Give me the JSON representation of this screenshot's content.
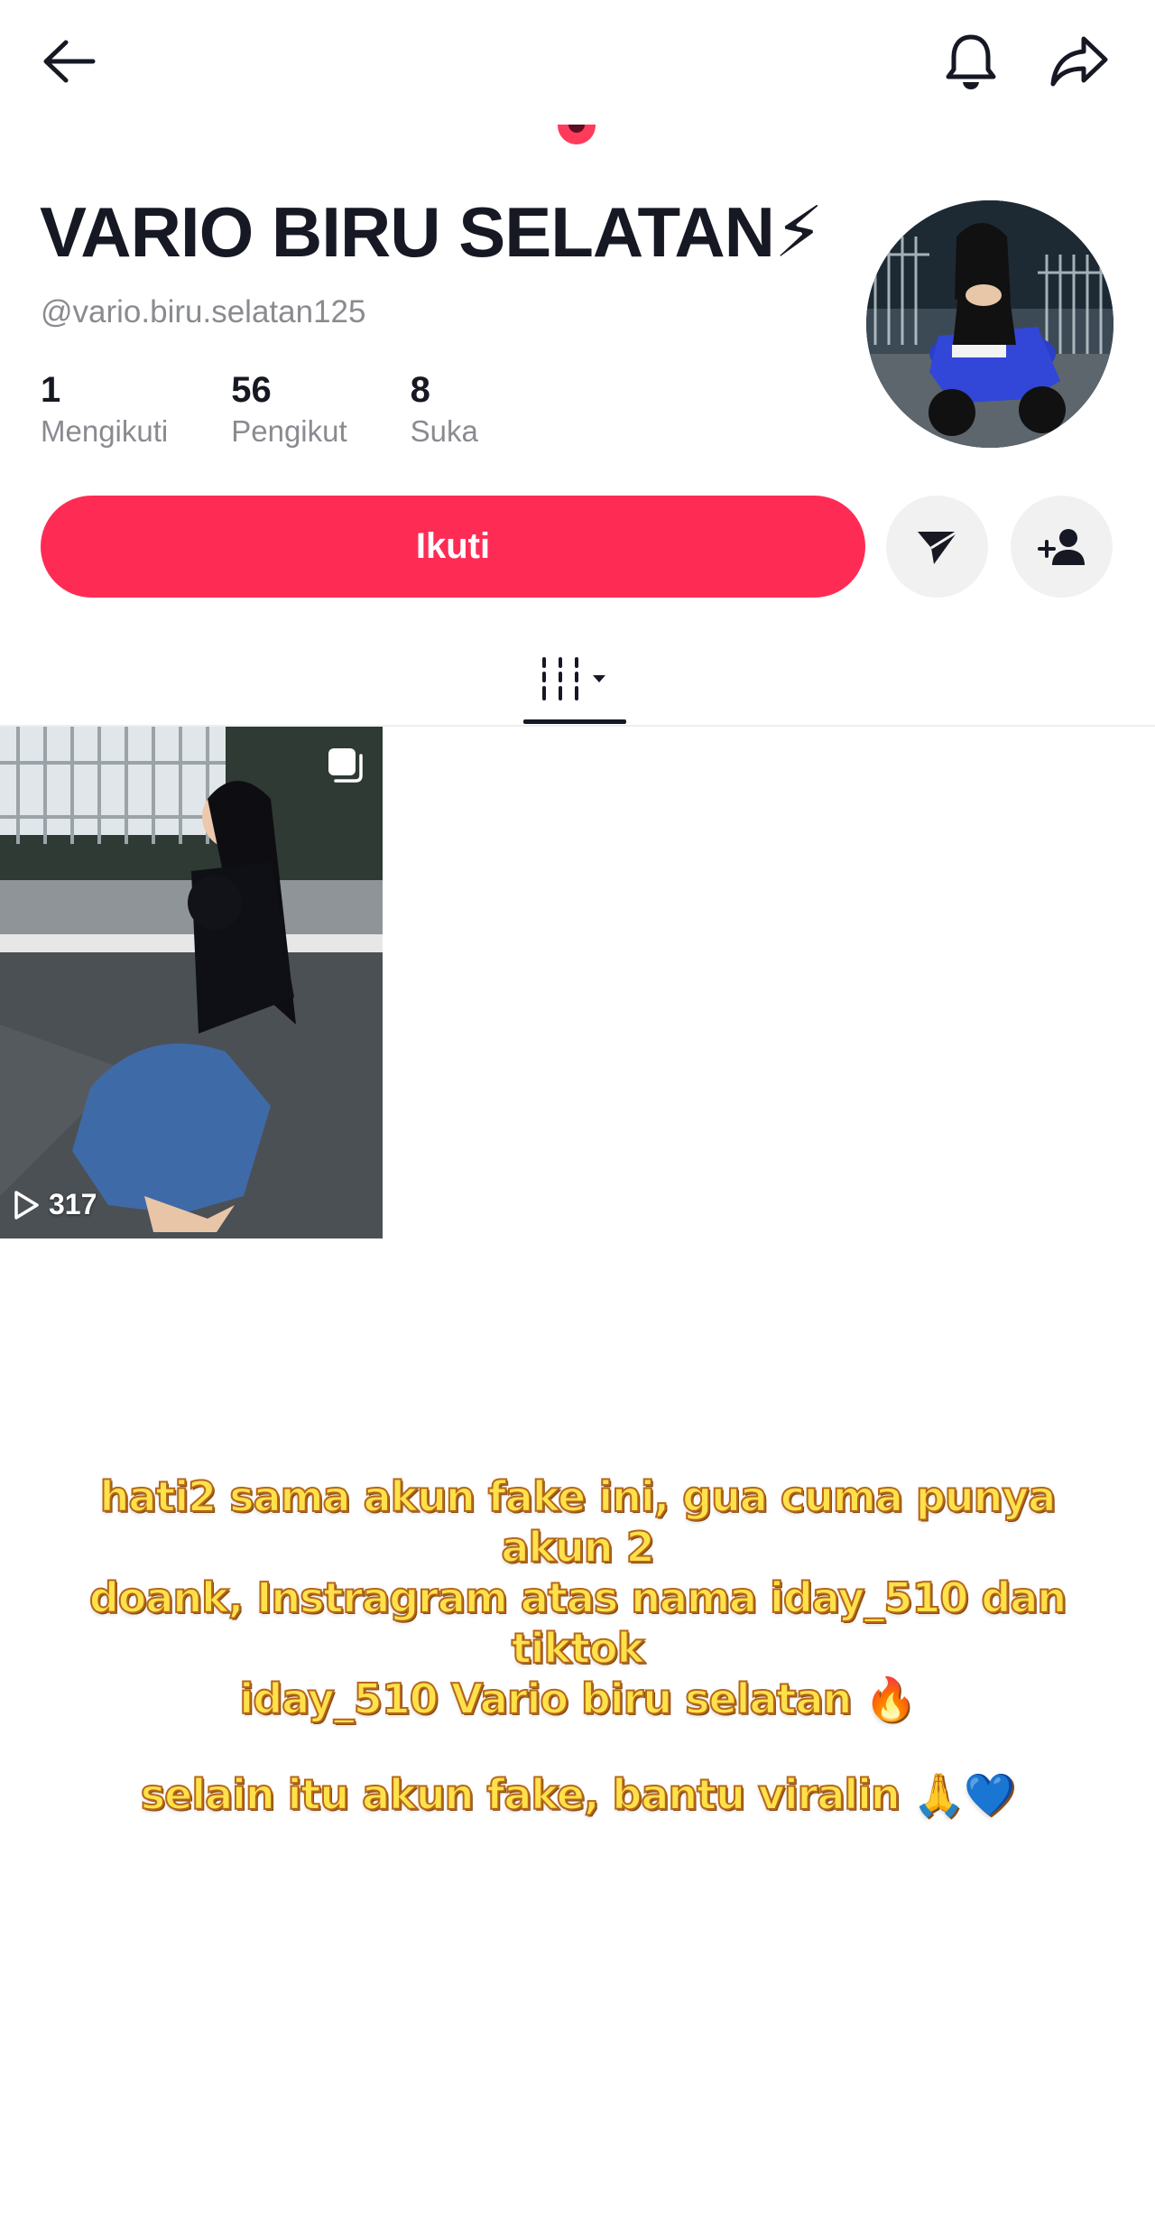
{
  "profile": {
    "display_name": "VARIO BIRU SELATAN⚡",
    "username": "@vario.biru.selatan125",
    "stats": [
      {
        "value": "1",
        "label": "Mengikuti"
      },
      {
        "value": "56",
        "label": "Pengikut"
      },
      {
        "value": "8",
        "label": "Suka"
      }
    ]
  },
  "actions": {
    "follow_label": "Ikuti"
  },
  "videos": [
    {
      "views": "317"
    }
  ],
  "overlay_text": {
    "line1": "hati2 sama akun fake ini, gua cuma punya akun 2",
    "line2": "doank, Instragram atas nama iday_510 dan tiktok",
    "line3": "iday_510 Vario biru selatan 🔥",
    "line4": "selain itu akun fake, bantu viralin 🙏💙"
  },
  "colors": {
    "accent": "#fe2c55",
    "text_primary": "#161823",
    "text_secondary": "#8a8b91",
    "secondary_button_bg": "#f1f1f2",
    "overlay_text": "#ffe14a"
  },
  "icons": {
    "back": "arrow-left-icon",
    "notifications": "bell-icon",
    "share": "share-arrow-icon",
    "message": "paper-plane-icon",
    "suggest": "add-user-icon",
    "videos_tab": "grid-videos-icon",
    "multi_photo": "photo-stack-icon",
    "play": "play-outline-icon"
  }
}
